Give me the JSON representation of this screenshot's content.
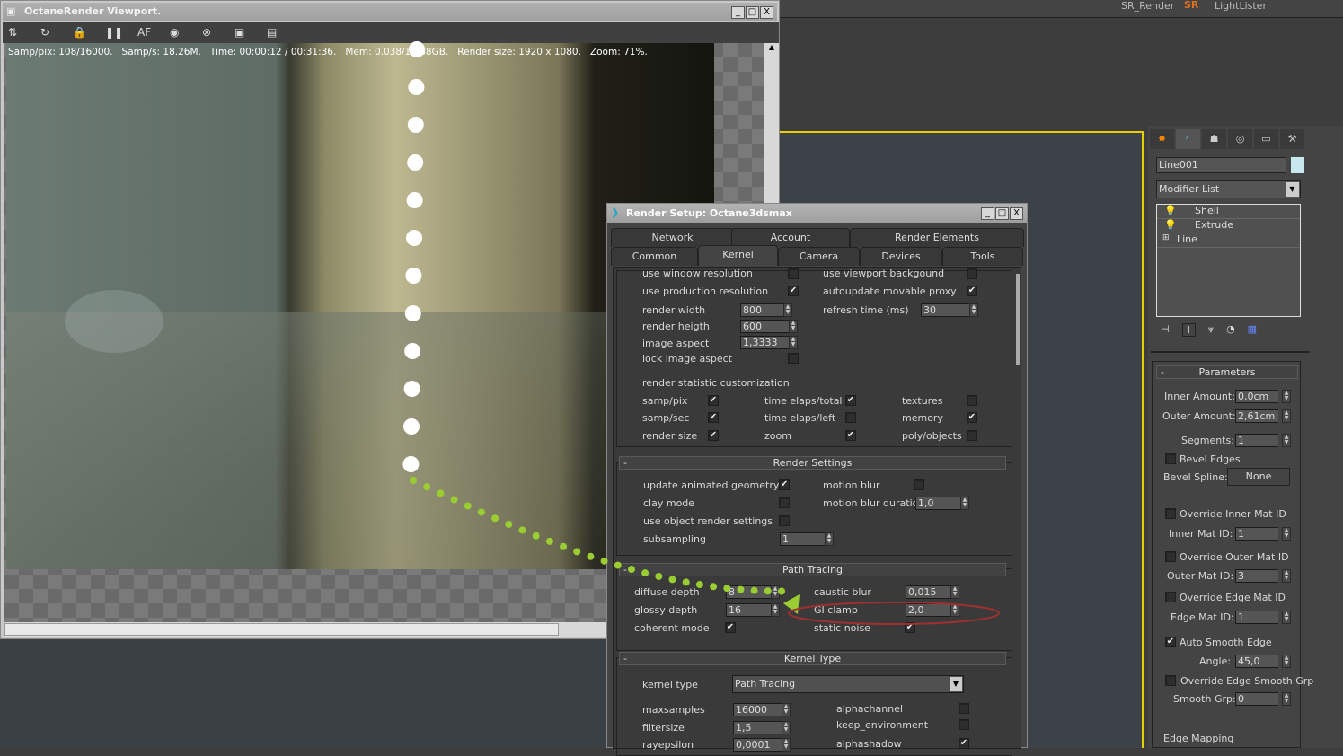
{
  "max_toolbar": {
    "labels": [
      "SR_Render",
      "SR",
      "LightLister"
    ]
  },
  "viewport_window": {
    "title": "OctaneRender Viewport.",
    "status": "Samp/pix: 108/16000.   Samp/s: 18.26M.   Time: 00:00:12 / 00:31:36.   Mem: 0.038/1.288GB.   Render size: 1920 x 1080.   Zoom: 71%.",
    "toolbar_icons": [
      "send-scene-icon",
      "restart-icon",
      "lock-icon",
      "pause-icon",
      "af-focus-icon",
      "color-picker-icon",
      "stop-render-icon",
      "save-display-icon",
      "film-icon"
    ]
  },
  "render_setup": {
    "title": "Render Setup: Octane3dsmax",
    "tabs_row1": [
      "Network",
      "Account",
      "Render Elements"
    ],
    "tabs_row2": [
      "Common",
      "Kernel",
      "Camera",
      "Devices",
      "Tools"
    ],
    "active_tab": "Kernel",
    "labels": {
      "l0": "use window resolution",
      "l1": "use viewport backgound",
      "l2": "use production resolution",
      "l3": "autoupdate movable proxy",
      "l4": "render width",
      "l5": "refresh time (ms)",
      "l6": "render heigth",
      "l7": "image aspect",
      "l8": "lock image aspect",
      "l9": "render statistic customization",
      "l10": "samp/pix",
      "l11": "time elaps/total",
      "l12": "textures",
      "l13": "samp/sec",
      "l14": "time elaps/left",
      "l15": "memory",
      "l16": "render size",
      "l17": "zoom",
      "l18": "poly/objects",
      "l19": "update animated geometry",
      "l20": "motion blur",
      "l21": "clay mode",
      "l22": "motion blur duration",
      "l23": "use object render settings",
      "l24": "subsampling",
      "l25": "diffuse depth",
      "l26": "caustic blur",
      "l27": "glossy depth",
      "l28": "GI clamp",
      "l29": "coherent mode",
      "l30": "static noise",
      "l31": "kernel type",
      "l32": "maxsamples",
      "l33": "alphachannel",
      "l34": "filtersize",
      "l35": "keep_environment",
      "l36": "rayepsilon",
      "l37": "alphashadow"
    },
    "checks": {
      "c0": false,
      "c1": false,
      "c2": true,
      "c3": true,
      "c4": false,
      "c5": true,
      "c6": true,
      "c7": false,
      "c8": true,
      "c9": false,
      "c10": true,
      "c11": true,
      "c12": true,
      "c13": false,
      "c14": true,
      "c15": false,
      "c16": false,
      "c17": false,
      "c18": true,
      "c19": true,
      "c20": false,
      "c21": false,
      "c22": true
    },
    "values": {
      "v0": "800",
      "v1": "30",
      "v2": "600",
      "v3": "1,3333",
      "v4": "1,0",
      "v5": "1",
      "v6": "8",
      "v7": "0,015",
      "v8": "16",
      "v9": "2,0",
      "v10": "16000",
      "v11": "1,5",
      "v12": "0,0001"
    },
    "sections": {
      "render_settings": "Render Settings",
      "path_tracing": "Path Tracing",
      "kernel_type": "Kernel Type"
    },
    "kernel_type_value": "Path Tracing"
  },
  "command_panel": {
    "object_name": "Line001",
    "object_color": "#c8e8f0",
    "modifier_list": "Modifier List",
    "stack": [
      {
        "label": "Shell"
      },
      {
        "label": "Extrude"
      },
      {
        "label": "Line"
      }
    ],
    "parameters": {
      "title": "Parameters",
      "inner_amount_label": "Inner Amount:",
      "inner_amount": "0,0cm",
      "outer_amount_label": "Outer Amount:",
      "outer_amount": "2,61cm",
      "segments_label": "Segments:",
      "segments": "1",
      "bevel_edges": "Bevel Edges",
      "bevel_spline_label": "Bevel Spline:",
      "bevel_spline": "None",
      "override_inner": "Override Inner Mat ID",
      "inner_mat_label": "Inner Mat ID:",
      "inner_mat": "1",
      "override_outer": "Override Outer Mat ID",
      "outer_mat_label": "Outer Mat ID:",
      "outer_mat": "3",
      "override_edge": "Override Edge Mat ID",
      "edge_mat_label": "Edge Mat ID:",
      "edge_mat": "1",
      "auto_smooth": "Auto Smooth Edge",
      "angle_label": "Angle:",
      "angle": "45,0",
      "override_smooth": "Override Edge Smooth Grp",
      "smooth_grp_label": "Smooth Grp:",
      "smooth_grp": "0",
      "edge_mapping": "Edge Mapping"
    },
    "checks": {
      "bevel_edges": false,
      "override_inner": false,
      "override_outer": false,
      "override_edge": false,
      "auto_smooth": true,
      "override_smooth": false
    }
  },
  "colors": {
    "annotation_dots_white": "#ffffff",
    "annotation_dots_green": "#9acd32",
    "annotation_circle": "#a03030",
    "viewport_border": "#e8d000"
  }
}
